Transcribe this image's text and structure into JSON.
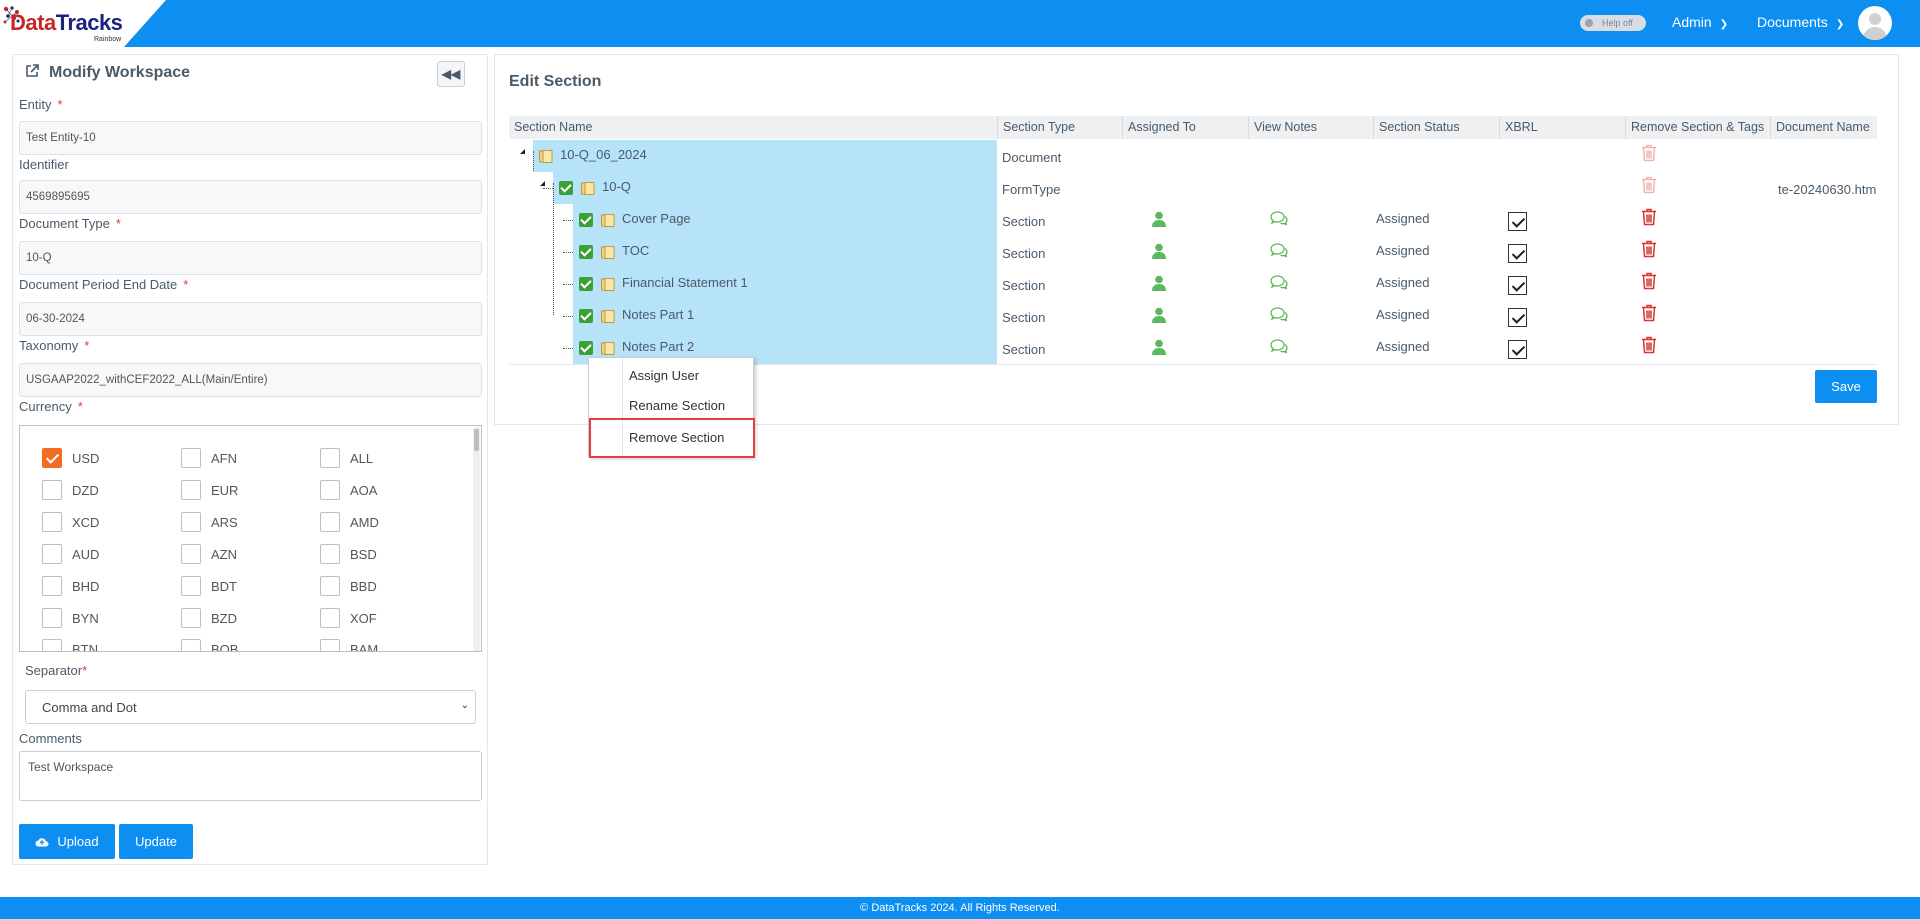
{
  "header": {
    "logo_main": "DataTracks",
    "logo_main_a": "Data",
    "logo_main_b": "Tracks",
    "logo_sub": "Rainbow",
    "help_toggle": "Help off",
    "admin_menu": "Admin",
    "documents_menu": "Documents"
  },
  "left": {
    "title": "Modify Workspace",
    "entity_label": "Entity",
    "entity_value": "Test Entity-10",
    "identifier_label": "Identifier",
    "identifier_value": "4569895695",
    "doctype_label": "Document Type",
    "doctype_value": "10-Q",
    "period_label": "Document Period End Date",
    "period_value": "06-30-2024",
    "taxonomy_label": "Taxonomy",
    "taxonomy_value": "USGAAP2022_withCEF2022_ALL(Main/Entire)",
    "currency_label": "Currency",
    "required_mark": "*",
    "currencies": [
      {
        "code": "USD",
        "checked": true
      },
      {
        "code": "AFN",
        "checked": false
      },
      {
        "code": "ALL",
        "checked": false
      },
      {
        "code": "DZD",
        "checked": false
      },
      {
        "code": "EUR",
        "checked": false
      },
      {
        "code": "AOA",
        "checked": false
      },
      {
        "code": "XCD",
        "checked": false
      },
      {
        "code": "ARS",
        "checked": false
      },
      {
        "code": "AMD",
        "checked": false
      },
      {
        "code": "AUD",
        "checked": false
      },
      {
        "code": "AZN",
        "checked": false
      },
      {
        "code": "BSD",
        "checked": false
      },
      {
        "code": "BHD",
        "checked": false
      },
      {
        "code": "BDT",
        "checked": false
      },
      {
        "code": "BBD",
        "checked": false
      },
      {
        "code": "BYN",
        "checked": false
      },
      {
        "code": "BZD",
        "checked": false
      },
      {
        "code": "XOF",
        "checked": false
      },
      {
        "code": "BTN",
        "checked": false
      },
      {
        "code": "BOB",
        "checked": false
      },
      {
        "code": "BAM",
        "checked": false
      }
    ],
    "separator_label": "Separator",
    "separator_value": "Comma and Dot",
    "comments_label": "Comments",
    "comments_value": "Test Workspace",
    "upload_button": "Upload",
    "update_button": "Update"
  },
  "right": {
    "title": "Edit Section",
    "columns": [
      "Section Name",
      "Section Type",
      "Assigned To",
      "View Notes",
      "Section Status",
      "XBRL",
      "Remove Section & Tags",
      "Document Name"
    ],
    "rows": [
      {
        "name": "10-Q_06_2024",
        "type": "Document",
        "status": "",
        "doc_name": "",
        "assigned": false,
        "xbrl": false,
        "checkbox": false
      },
      {
        "name": "10-Q",
        "type": "FormType",
        "status": "",
        "doc_name": "te-20240630.htm",
        "assigned": false,
        "xbrl": false,
        "checkbox": true
      },
      {
        "name": "Cover Page",
        "type": "Section",
        "status": "Assigned",
        "doc_name": "",
        "assigned": true,
        "xbrl": true,
        "checkbox": true
      },
      {
        "name": "TOC",
        "type": "Section",
        "status": "Assigned",
        "doc_name": "",
        "assigned": true,
        "xbrl": true,
        "checkbox": true
      },
      {
        "name": "Financial Statement 1",
        "type": "Section",
        "status": "Assigned",
        "doc_name": "",
        "assigned": true,
        "xbrl": true,
        "checkbox": true
      },
      {
        "name": "Notes Part 1",
        "type": "Section",
        "status": "Assigned",
        "doc_name": "",
        "assigned": true,
        "xbrl": true,
        "checkbox": true
      },
      {
        "name": "Notes Part 2",
        "type": "Section",
        "status": "Assigned",
        "doc_name": "",
        "assigned": true,
        "xbrl": true,
        "checkbox": true
      }
    ],
    "save_button": "Save"
  },
  "context_menu": {
    "items": [
      "Assign User",
      "Rename Section",
      "Remove Section"
    ],
    "highlighted": "Remove Section"
  },
  "footer": {
    "text": "© DataTracks 2024. All Rights Reserved."
  },
  "colors": {
    "brand_blue": "#0d8ff2",
    "selection_blue": "#b6e3f7",
    "check_orange": "#f36c21",
    "icon_green": "#5cb85c",
    "delete_red": "#d9342b",
    "highlight_red": "#e04040"
  },
  "icons": [
    "external-link-icon",
    "double-chevron-left-icon",
    "cloud-upload-icon",
    "user-icon",
    "comments-icon",
    "trash-icon",
    "folder-icon",
    "chevron-down-icon",
    "avatar-icon"
  ]
}
